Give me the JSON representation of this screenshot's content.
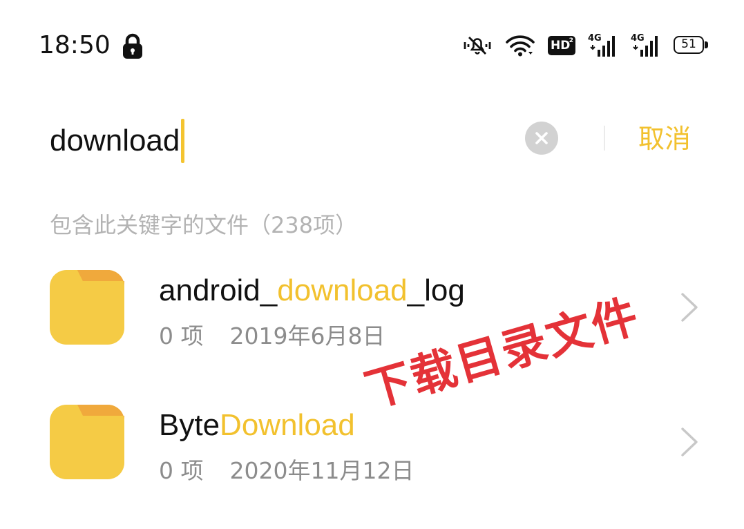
{
  "status_bar": {
    "time": "18:50",
    "hd_label": "HD",
    "hd_sub": "2",
    "signal_1_label": "4G",
    "signal_2_label": "4G",
    "battery_level": "51"
  },
  "search": {
    "query": "download",
    "cancel_label": "取消"
  },
  "results": {
    "header": "包含此关键字的文件（238项）",
    "files": [
      {
        "name_prefix": "android_",
        "name_match": "download",
        "name_suffix": "_log",
        "count": "0 项",
        "date": "2019年6月8日"
      },
      {
        "name_prefix": "Byte",
        "name_match": "Download",
        "name_suffix": "",
        "count": "0 项",
        "date": "2020年11月12日"
      }
    ]
  },
  "annotation": {
    "text": "下载目录文件"
  },
  "colors": {
    "accent": "#f2c12e",
    "folder": "#f5cb45",
    "folder_tab": "#f0a93c",
    "annotation_red": "#e3282e",
    "muted_text": "#8c8c8c"
  },
  "icons": {
    "lock": "lock-icon",
    "mute": "bell-off-icon",
    "wifi": "wifi-icon",
    "clear": "close-icon",
    "folder": "folder-icon",
    "chevron": "chevron-right-icon"
  }
}
